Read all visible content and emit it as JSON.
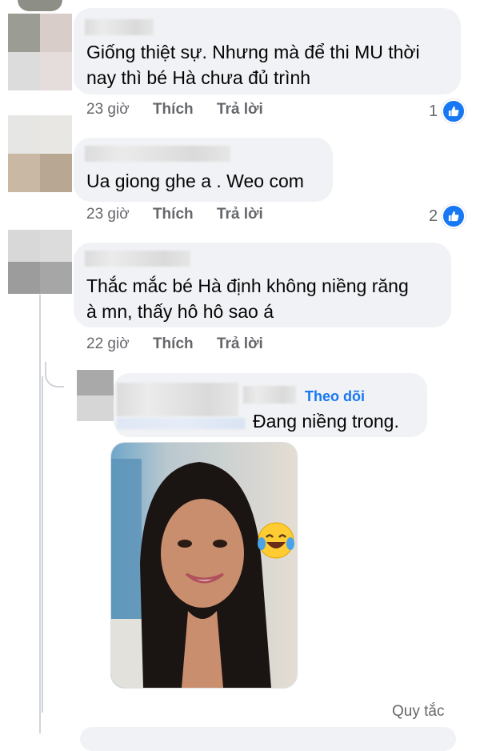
{
  "comments": [
    {
      "text_lines": [
        "Giống thiệt sự. Nhưng mà để thi MU thời",
        "nay thì bé Hà chưa đủ trình"
      ],
      "time": "23 giờ",
      "like_label": "Thích",
      "reply_label": "Trả lời",
      "reaction_count": "1"
    },
    {
      "text_lines": [
        "Ua giong ghe a . Weo com"
      ],
      "time": "23 giờ",
      "like_label": "Thích",
      "reply_label": "Trả lời",
      "reaction_count": "2"
    },
    {
      "text_lines": [
        "Thắc mắc bé Hà định không niềng răng",
        "à mn, thấy hô hô sao á"
      ],
      "time": "22 giờ",
      "like_label": "Thích",
      "reply_label": "Trả lời",
      "reaction_count": ""
    }
  ],
  "reply": {
    "follow_label": "Theo dõi",
    "text": "Đang niềng trong.",
    "photo_icon": "laughing-tears-emoji-sticker"
  },
  "footer": {
    "rules_label": "Quy tắc"
  },
  "colors": {
    "accent": "#1877f2",
    "bubble": "#f0f2f5",
    "meta": "#65676b"
  }
}
